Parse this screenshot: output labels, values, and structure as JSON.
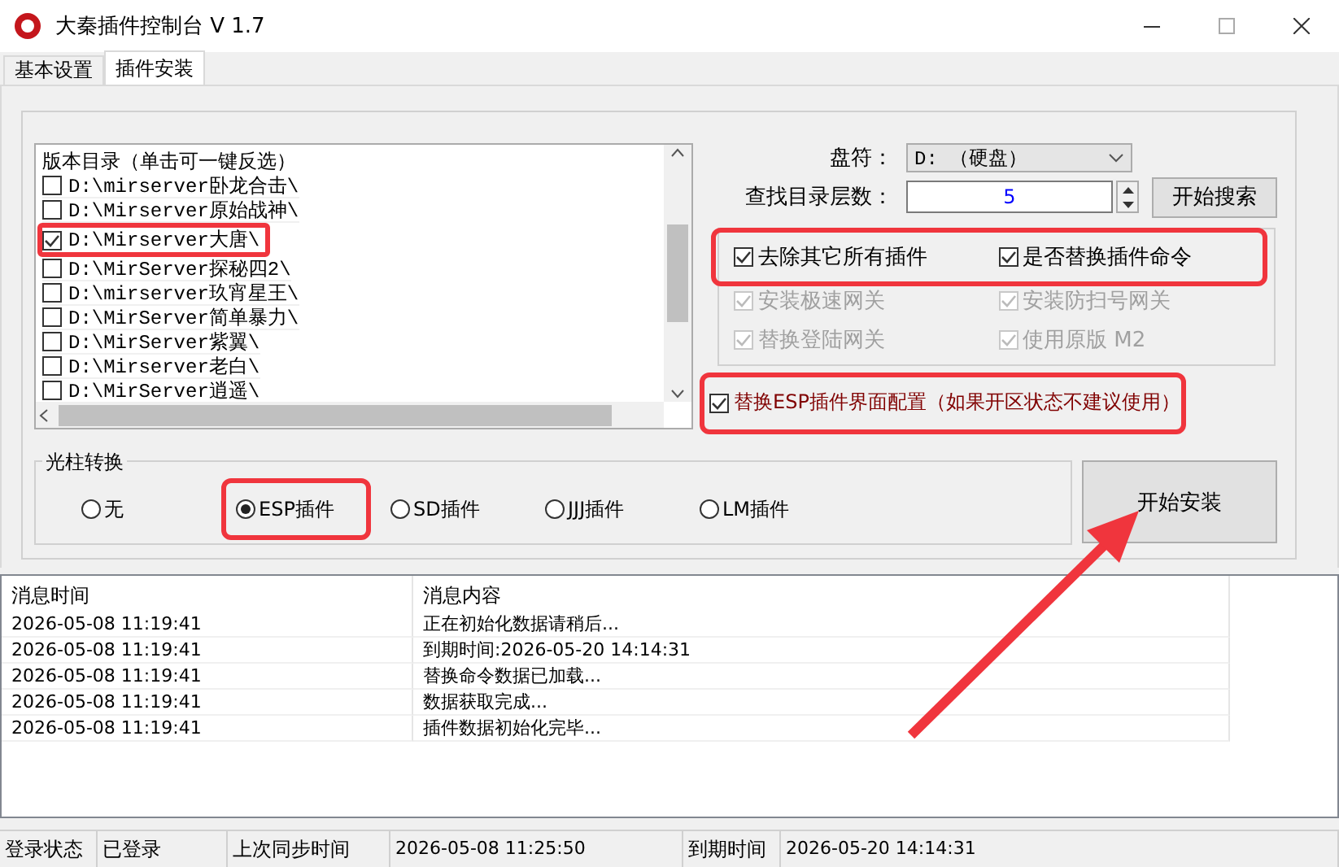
{
  "window": {
    "title": "大秦插件控制台 V 1.7"
  },
  "tabs": [
    {
      "label": "基本设置",
      "selected": false
    },
    {
      "label": "插件安装",
      "selected": true
    }
  ],
  "directory_list": {
    "header": "版本目录（单击可一键反选）",
    "items": [
      {
        "path": "D:\\mirserver卧龙合击\\",
        "checked": false,
        "highlighted": false
      },
      {
        "path": "D:\\Mirserver原始战神\\",
        "checked": false,
        "highlighted": false
      },
      {
        "path": "D:\\Mirserver大唐\\",
        "checked": true,
        "highlighted": true
      },
      {
        "path": "D:\\MirServer探秘四2\\",
        "checked": false,
        "highlighted": false
      },
      {
        "path": "D:\\mirserver玖宵星王\\",
        "checked": false,
        "highlighted": false
      },
      {
        "path": "D:\\MirServer简单暴力\\",
        "checked": false,
        "highlighted": false
      },
      {
        "path": "D:\\MirServer紫翼\\",
        "checked": false,
        "highlighted": false
      },
      {
        "path": "D:\\Mirserver老白\\",
        "checked": false,
        "highlighted": false
      },
      {
        "path": "D:\\MirServer逍遥\\",
        "checked": false,
        "highlighted": false
      }
    ]
  },
  "drive": {
    "label": "盘符：",
    "value": "D: （硬盘）"
  },
  "search_depth": {
    "label": "查找目录层数：",
    "value": "5"
  },
  "search_button": "开始搜索",
  "option_rows": [
    {
      "highlighted": true,
      "items": [
        {
          "label": "去除其它所有插件",
          "checked": true,
          "disabled": false
        },
        {
          "label": "是否替换插件命令",
          "checked": true,
          "disabled": false
        }
      ]
    },
    {
      "highlighted": false,
      "items": [
        {
          "label": "安装极速网关",
          "checked": true,
          "disabled": true
        },
        {
          "label": "安装防扫号网关",
          "checked": true,
          "disabled": true
        }
      ]
    },
    {
      "highlighted": false,
      "items": [
        {
          "label": "替换登陆网关",
          "checked": true,
          "disabled": true
        },
        {
          "label": "使用原版 M2",
          "checked": true,
          "disabled": true
        }
      ]
    }
  ],
  "esp_ui_option": {
    "label": "替换ESP插件界面配置（如果开区状态不建议使用）",
    "checked": true,
    "highlighted": true
  },
  "light_column": {
    "title": "光柱转换",
    "options": [
      {
        "label": "无",
        "selected": false,
        "highlighted": false
      },
      {
        "label": "ESP插件",
        "selected": true,
        "highlighted": true
      },
      {
        "label": "SD插件",
        "selected": false,
        "highlighted": false
      },
      {
        "label": "JJJ插件",
        "selected": false,
        "highlighted": false
      },
      {
        "label": "LM插件",
        "selected": false,
        "highlighted": false
      }
    ]
  },
  "install_button": "开始安装",
  "log": {
    "columns": [
      "消息时间",
      "消息内容"
    ],
    "rows": [
      {
        "time": "2026-05-08 11:19:41",
        "message": "正在初始化数据请稍后..."
      },
      {
        "time": "2026-05-08 11:19:41",
        "message": "到期时间:2026-05-20 14:14:31"
      },
      {
        "time": "2026-05-08 11:19:41",
        "message": "替换命令数据已加载..."
      },
      {
        "time": "2026-05-08 11:19:41",
        "message": "数据获取完成..."
      },
      {
        "time": "2026-05-08 11:19:41",
        "message": "插件数据初始化完毕..."
      }
    ]
  },
  "status_bar": [
    "登录状态",
    "已登录",
    "上次同步时间",
    "2026-05-08 11:25:50",
    "到期时间",
    "2026-05-20 14:14:31"
  ]
}
